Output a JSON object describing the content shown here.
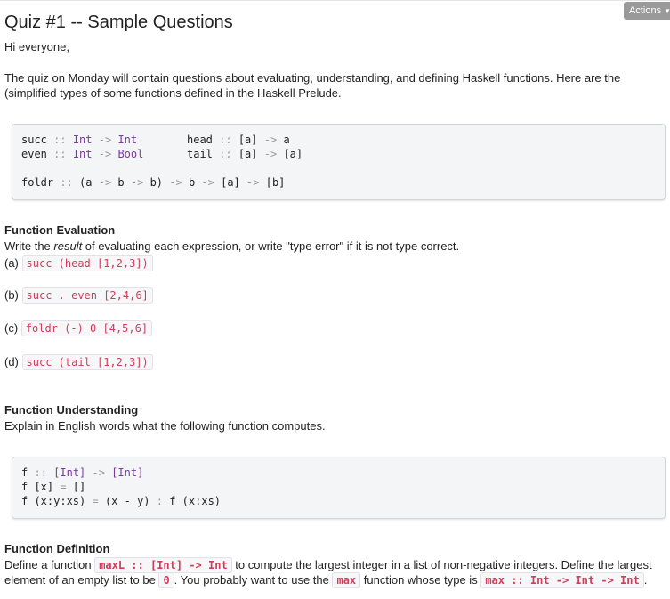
{
  "header": {
    "actions_label": "Actions"
  },
  "title": "Quiz #1 -- Sample Questions",
  "greeting": "Hi everyone,",
  "intro": "The quiz on Monday will contain questions about evaluating, understanding, and defining Haskell functions. Here are the (simplified types of some functions defined in the Haskell Prelude.",
  "prelude": {
    "succ_name": "succ",
    "succ_t1": "Int",
    "succ_t2": "Int",
    "even_name": "even",
    "even_t1": "Int",
    "even_t2": "Bool",
    "head_name": "head",
    "head_t1": "[a]",
    "head_t2": "a",
    "tail_name": "tail",
    "tail_t1": "[a]",
    "tail_t2": "[a]",
    "foldr_name": "foldr",
    "foldr_a": "(a",
    "foldr_b": "b",
    "foldr_c": "b)",
    "foldr_d": "b",
    "foldr_e": "[a]",
    "foldr_f": "[b]"
  },
  "evaluation": {
    "heading": "Function Evaluation",
    "instr_before": "Write the ",
    "instr_em": "result",
    "instr_after": " of evaluating each expression, or write \"type error\" if it is not type correct.",
    "items": [
      {
        "label": "(a)",
        "code": "succ (head [1,2,3])"
      },
      {
        "label": "(b)",
        "code": "succ . even [2,4,6]"
      },
      {
        "label": "(c)",
        "code": "foldr (-) 0 [4,5,6]"
      },
      {
        "label": "(d)",
        "code": "succ (tail [1,2,3])"
      }
    ]
  },
  "understanding": {
    "heading": "Function Understanding",
    "instr": "Explain in English words what the following function computes.",
    "l1_name": "f",
    "l1_t1": "[Int]",
    "l1_t2": "[Int]",
    "l2_a": "f [x]",
    "l2_b": "[]",
    "l3_a": "f (x:y:xs)",
    "l3_b": "(x - y)",
    "l3_c": "f (x:xs)"
  },
  "definition": {
    "heading": "Function Definition",
    "t1": "Define a function ",
    "c1": "maxL :: [Int] -> Int",
    "t2": " to compute the largest integer in a list of non-negative integers. Define the largest",
    "t3": "element of an empty list to be ",
    "c2": "0",
    "t4": ". You probably want to use the ",
    "c3": "max",
    "t5": " function whose type is ",
    "c4": "max :: Int -> Int -> Int",
    "t6": "."
  }
}
